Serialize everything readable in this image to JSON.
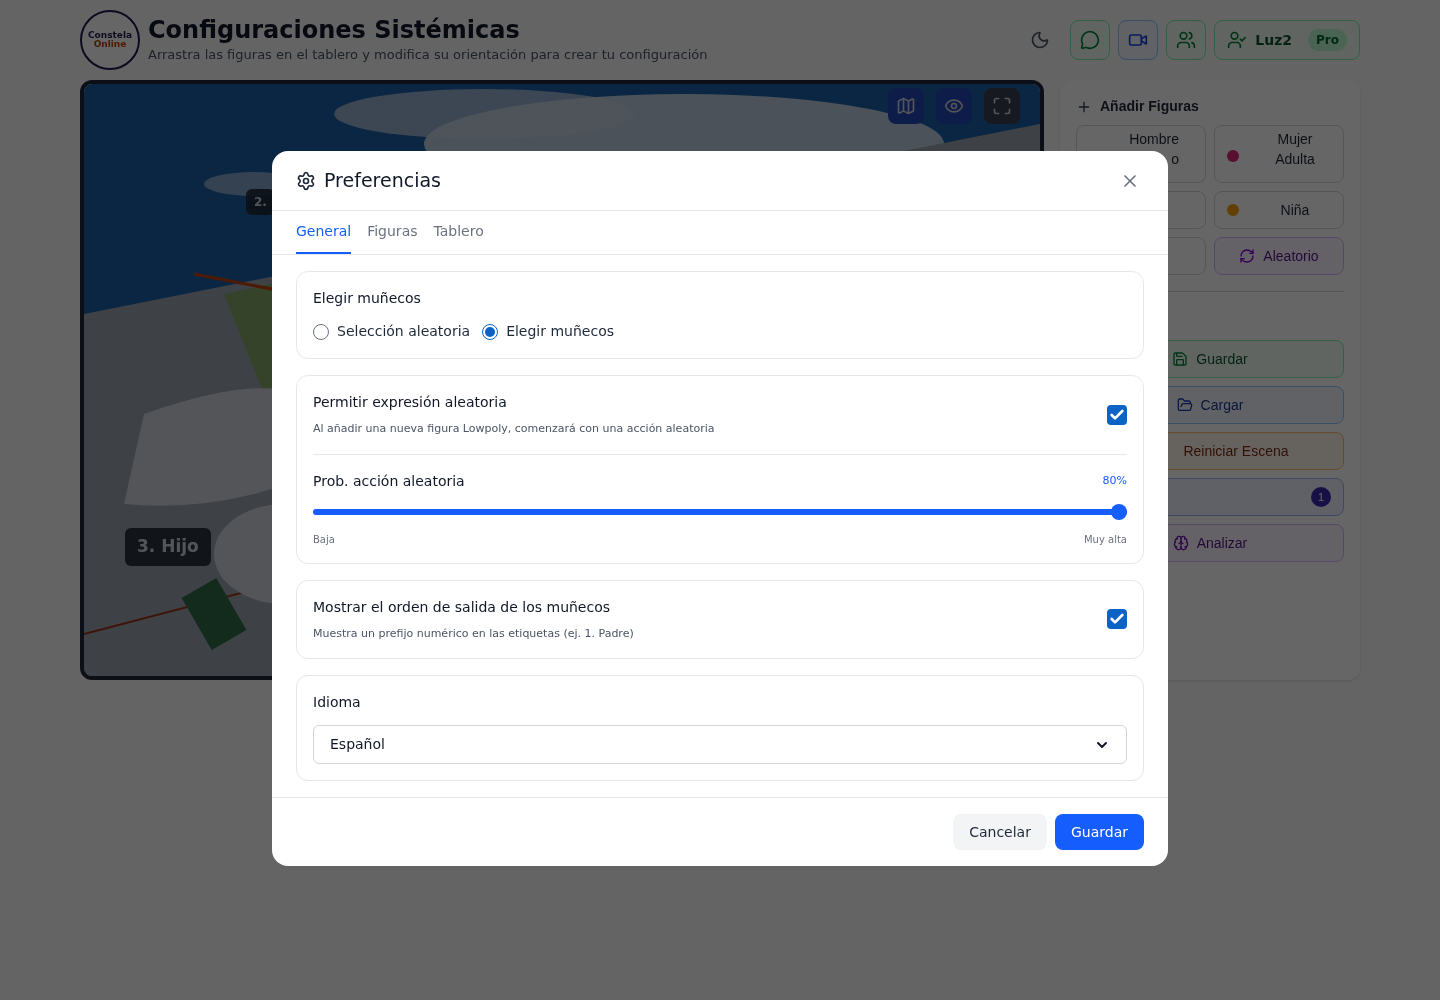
{
  "header": {
    "logo": {
      "line1": "Constela",
      "line2": "Online"
    },
    "title": "Configuraciones Sistémicas",
    "subtitle": "Arrastra las figuras en el tablero y modifica su orientación para crear tu configuración",
    "user": {
      "name": "Luz2",
      "plan": "Pro"
    }
  },
  "board": {
    "labels": [
      {
        "text": "2.",
        "kind": "small"
      },
      {
        "text": "3. Hijo",
        "kind": "large"
      }
    ]
  },
  "panel": {
    "title": "Añadir Figuras",
    "figures": [
      {
        "kind": "figure",
        "lines": [
          "Hombre",
          "o"
        ]
      },
      {
        "kind": "figure",
        "lines": [
          "Mujer",
          "Adulta"
        ],
        "color": "#581030"
      },
      {
        "kind": "figure"
      },
      {
        "kind": "figure",
        "lines": [
          "Niña"
        ],
        "color": "#623f04"
      },
      {
        "kind": "figure"
      },
      {
        "kind": "random",
        "lines": [
          "Aleatorio"
        ]
      }
    ],
    "actions": [
      {
        "kind": "save",
        "label": "Guardar"
      },
      {
        "kind": "load",
        "label": "Cargar"
      },
      {
        "kind": "reset",
        "label": "Reiniciar Escena"
      },
      {
        "kind": "count",
        "badge": "1"
      },
      {
        "kind": "analyze",
        "label": "Analizar"
      }
    ]
  },
  "dialog": {
    "title": "Preferencias",
    "tabs": [
      {
        "label": "General",
        "selected": true
      },
      {
        "label": "Figuras",
        "selected": false
      },
      {
        "label": "Tablero",
        "selected": false
      }
    ],
    "choose": {
      "title": "Elegir muñecos",
      "options": [
        {
          "label": "Selección aleatoria",
          "selected": false
        },
        {
          "label": "Elegir muñecos",
          "selected": true
        }
      ]
    },
    "random_expression": {
      "title": "Permitir expresión aleatoria",
      "description": "Al añadir una nueva figura Lowpoly, comenzará con una acción aleatoria",
      "checked": true,
      "slider": {
        "label": "Prob. acción aleatoria",
        "reading": "80%",
        "level": 1,
        "min_label": "Baja",
        "max_label": "Muy alta"
      }
    },
    "order": {
      "title": "Mostrar el orden de salida de los muñecos",
      "description": "Muestra un prefijo numérico en las etiquetas (ej. 1. Padre)",
      "checked": true
    },
    "language": {
      "title": "Idioma",
      "value": "Español"
    },
    "buttons": [
      {
        "kind": "secondary",
        "label": "Cancelar"
      },
      {
        "kind": "primary",
        "label": "Guardar"
      }
    ]
  }
}
